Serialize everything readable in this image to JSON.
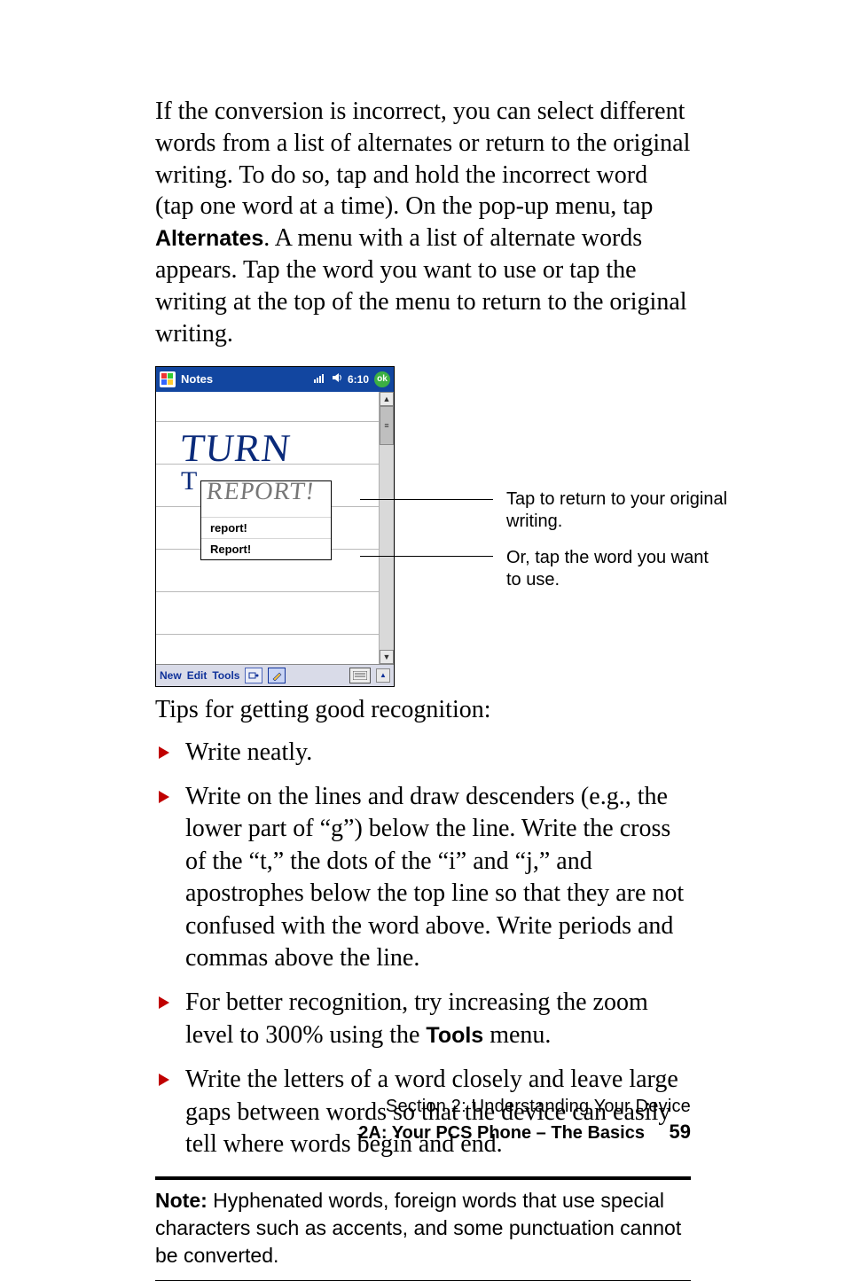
{
  "intro": {
    "part1": "If the conversion is incorrect, you can select different words from a list of alternates or return to the original writing. To do so, tap and hold the incorrect word (tap one word at a time). On the pop-up menu, tap ",
    "bold": "Alternates",
    "part2": ". A menu with a list of alternate words appears. Tap the word you want to use or tap the writing at the top of the menu to return to the original writing."
  },
  "screenshot": {
    "app_title": "Notes",
    "clock": "6:10",
    "ok_label": "ok",
    "handwriting_top": "TURN",
    "handwriting_frag": "T",
    "handwriting_popup": "REPORT!",
    "alt_options": [
      "report!",
      "Report!"
    ],
    "menubar": {
      "new": "New",
      "edit": "Edit",
      "tools": "Tools"
    }
  },
  "callouts": {
    "c1": "Tap to return to your original writing.",
    "c2": "Or, tap the word you want to use."
  },
  "tips_intro": "Tips for getting good recognition:",
  "tips": [
    {
      "text": "Write neatly."
    },
    {
      "text": "Write on the lines and draw descenders (e.g., the lower part of “g”) below the line. Write the cross of the “t,” the dots of the “i” and “j,” and apostrophes below the top line so that they are not confused with the word above. Write periods and commas above the line."
    },
    {
      "pre": "For better recognition, try increasing the zoom level to 300% using the ",
      "bold": "Tools",
      "post": " menu."
    },
    {
      "text": "Write the letters of a word closely and leave large gaps between words so that the device can easily tell where words begin and end."
    }
  ],
  "note": {
    "label": "Note:",
    "text": " Hyphenated words, foreign words that use special characters such as accents, and some punctuation cannot be converted."
  },
  "footer": {
    "section_line": "Section 2: Understanding Your Device",
    "chapter": "2A: Your PCS Phone – The Basics",
    "page": "59"
  }
}
